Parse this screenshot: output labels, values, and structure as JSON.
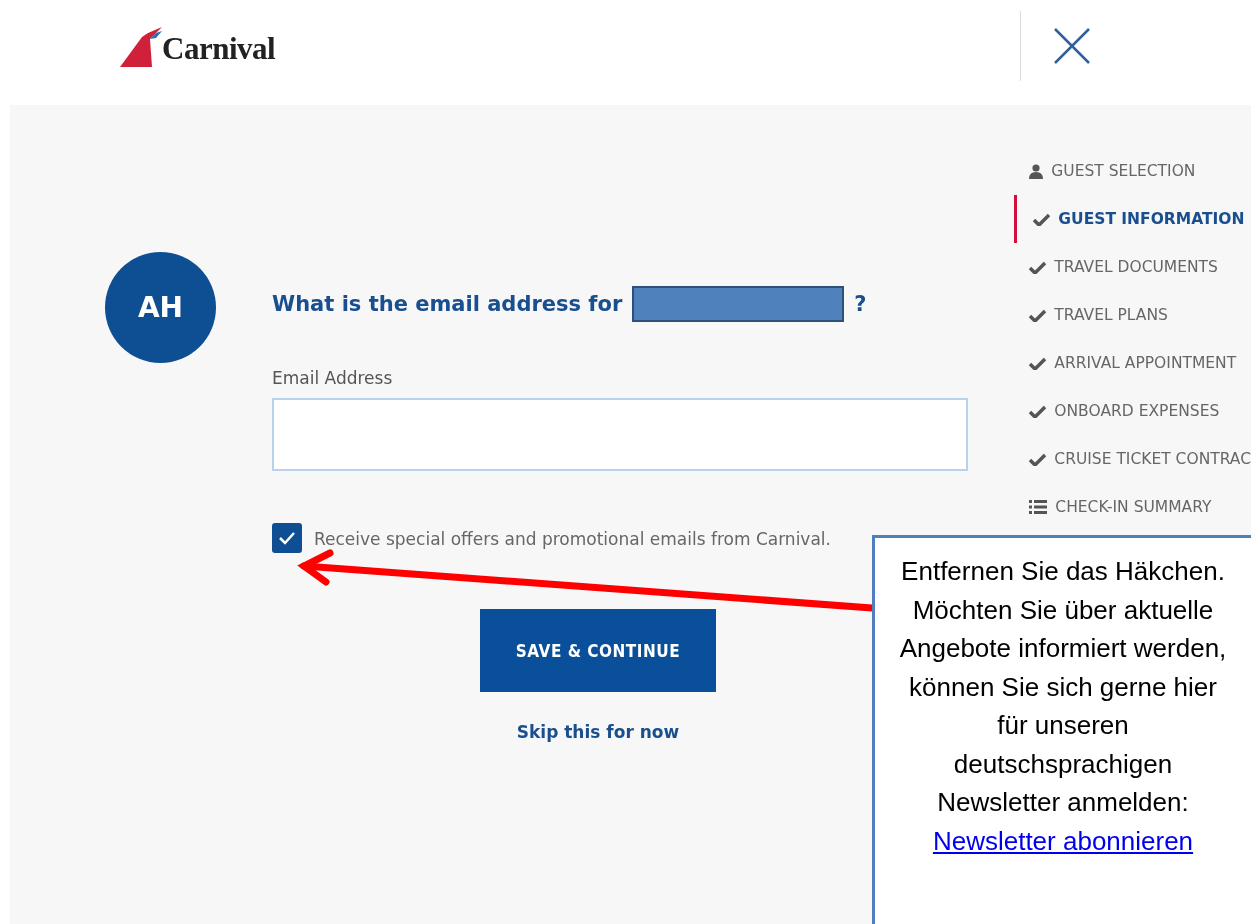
{
  "header": {
    "logo": "Carnival"
  },
  "avatar": {
    "initials": "AH"
  },
  "form": {
    "question": "What is the email address for",
    "question_end": "?",
    "email_label": "Email Address",
    "offers_checked": true,
    "offers_label": "Receive special offers and promotional emails from Carnival.",
    "save_button": "SAVE & CONTINUE",
    "skip_link": "Skip this for now"
  },
  "steps": [
    {
      "label": "GUEST SELECTION",
      "kind": "person",
      "selected": false
    },
    {
      "label": "GUEST INFORMATION",
      "kind": "check",
      "selected": true
    },
    {
      "label": "TRAVEL DOCUMENTS",
      "kind": "check",
      "selected": false
    },
    {
      "label": "TRAVEL PLANS",
      "kind": "check",
      "selected": false
    },
    {
      "label": "ARRIVAL APPOINTMENT",
      "kind": "check",
      "selected": false
    },
    {
      "label": "ONBOARD EXPENSES",
      "kind": "check",
      "selected": false
    },
    {
      "label": "CRUISE TICKET CONTRAC",
      "kind": "check",
      "selected": false
    },
    {
      "label": "CHECK-IN SUMMARY",
      "kind": "list",
      "selected": false
    }
  ],
  "callout": {
    "text": "Entfernen Sie das Häkchen. Möchten Sie über aktuelle Angebote informiert werden, können Sie sich gerne hier für unseren deutschsprachigen Newsletter anmelden:",
    "link": "Newsletter abonnieren"
  }
}
